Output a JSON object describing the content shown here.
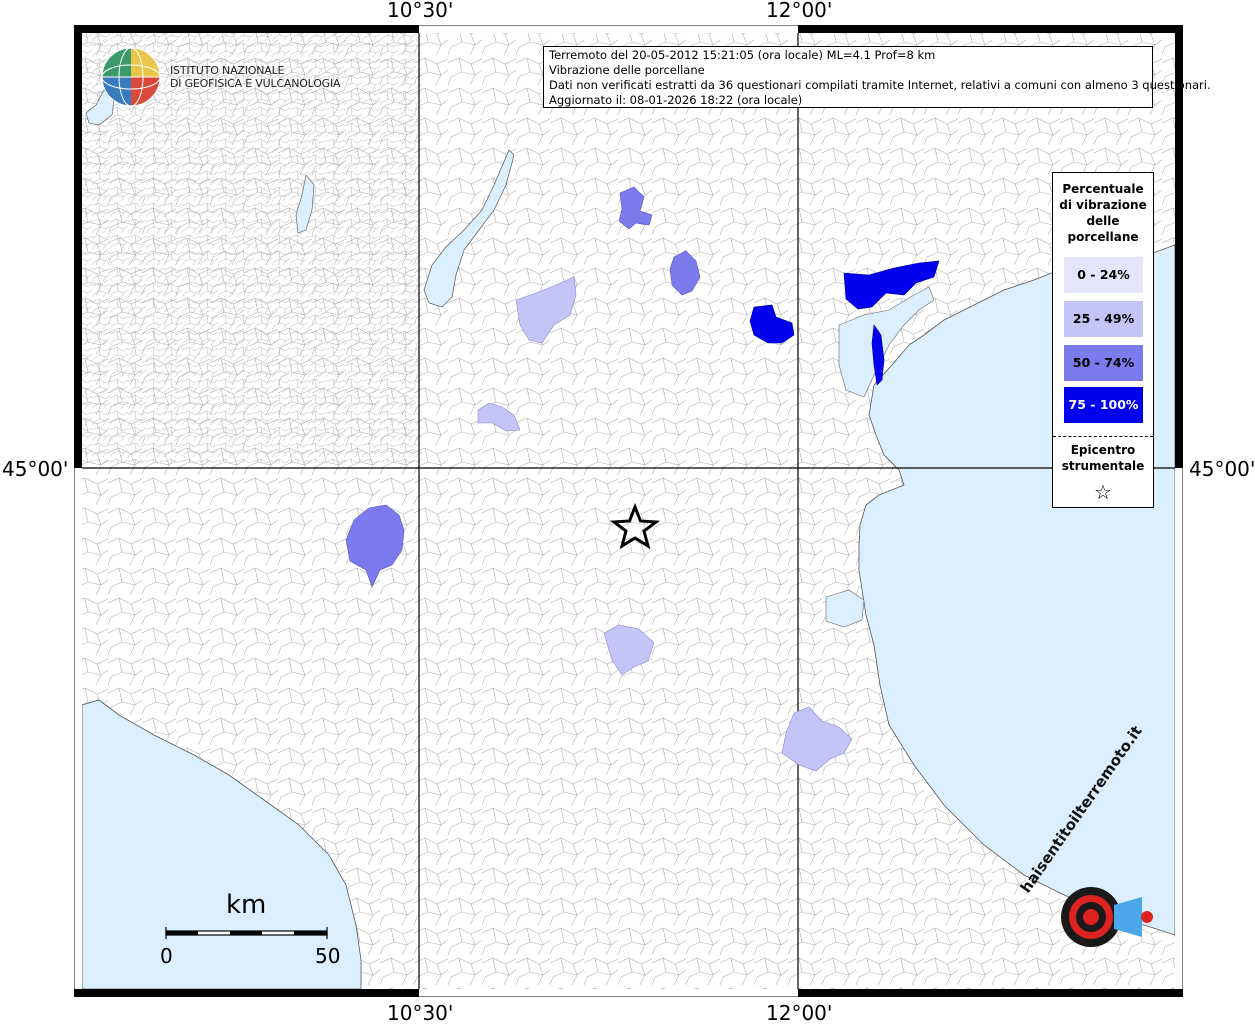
{
  "coordinates": {
    "top_left": "10°30'",
    "top_right": "12°00'",
    "bottom_left": "10°30'",
    "bottom_right": "12°00'",
    "left": "45°00'",
    "right": "45°00'"
  },
  "info_box": {
    "line1": "Terremoto del 20-05-2012 15:21:05 (ora locale) ML=4.1 Prof=8 km",
    "line2": "Vibrazione delle porcellane",
    "line3": "Dati non verificati estratti da 36 questionari compilati tramite Internet, relativi a comuni con almeno 3 questionari.",
    "line4": "Aggiornato il: 08-01-2026 18:22 (ora locale)"
  },
  "legend": {
    "title_lines": [
      "Percentuale",
      "di vibrazione",
      "delle",
      "porcellane"
    ],
    "classes": [
      {
        "label": "0 - 24%",
        "color": "#e4e4fa",
        "text_color": "#000000"
      },
      {
        "label": "25 - 49%",
        "color": "#c4c4f6",
        "text_color": "#000000"
      },
      {
        "label": "50 - 74%",
        "color": "#7b7bee",
        "text_color": "#000000"
      },
      {
        "label": "75 - 100%",
        "color": "#0000ee",
        "text_color": "#ffffff"
      }
    ],
    "epicenter_lines": [
      "Epicentro",
      "strumentale"
    ],
    "epicenter_symbol": "☆"
  },
  "institute": {
    "line1": "ISTITUTO NAZIONALE",
    "line2": "DI GEOFISICA E VULCANOLOGIA"
  },
  "scale_bar": {
    "unit": "km",
    "min_label": "0",
    "max_label": "50"
  },
  "colors": {
    "sea": "#dcefff",
    "land": "#ffffff",
    "borders": "#b0b0b0"
  },
  "logo_text": "haisentitoilterremoto.it"
}
